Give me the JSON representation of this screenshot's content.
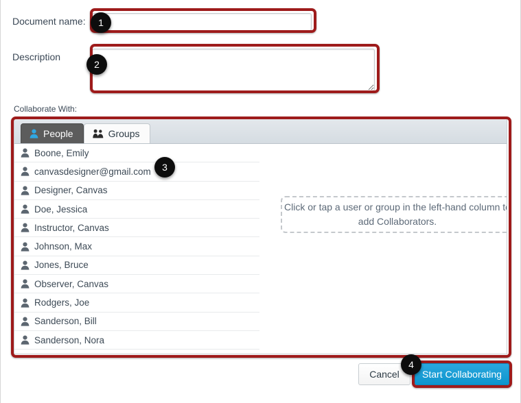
{
  "form": {
    "document_name_label": "Document name:",
    "document_name_value": "",
    "document_name_placeholder": "",
    "description_label": "Description",
    "description_value": "",
    "description_placeholder": "",
    "collaborate_with_label": "Collaborate With:"
  },
  "tabs": [
    {
      "label": "People",
      "icon": "person-icon",
      "active": true
    },
    {
      "label": "Groups",
      "icon": "group-icon",
      "active": false
    }
  ],
  "people": [
    {
      "name": "Boone, Emily",
      "icon": "person-icon"
    },
    {
      "name": "canvasdesigner@gmail.com",
      "icon": "person-icon"
    },
    {
      "name": "Designer, Canvas",
      "icon": "person-icon"
    },
    {
      "name": "Doe, Jessica",
      "icon": "person-icon"
    },
    {
      "name": "Instructor, Canvas",
      "icon": "person-icon"
    },
    {
      "name": "Johnson, Max",
      "icon": "person-icon"
    },
    {
      "name": "Jones, Bruce",
      "icon": "person-icon"
    },
    {
      "name": "Observer, Canvas",
      "icon": "person-icon"
    },
    {
      "name": "Rodgers, Joe",
      "icon": "person-icon"
    },
    {
      "name": "Sanderson, Bill",
      "icon": "person-icon"
    },
    {
      "name": "Sanderson, Nora",
      "icon": "person-icon"
    }
  ],
  "dropzone": {
    "text": "Click or tap a user or group in the left-hand column to add Collaborators."
  },
  "footer": {
    "cancel_label": "Cancel",
    "start_label": "Start Collaborating"
  },
  "annotations": [
    {
      "number": "1",
      "target": "document-name-field"
    },
    {
      "number": "2",
      "target": "description-field"
    },
    {
      "number": "3",
      "target": "collaborate-with-panel"
    },
    {
      "number": "4",
      "target": "start-collaborating-button"
    }
  ],
  "colors": {
    "highlight": "#9e1b1b",
    "badge": "#0d0d0d",
    "primary_button": "#0d95ce",
    "active_tab": "#5c5c5c",
    "tab_icon_blue": "#30a7e3"
  }
}
